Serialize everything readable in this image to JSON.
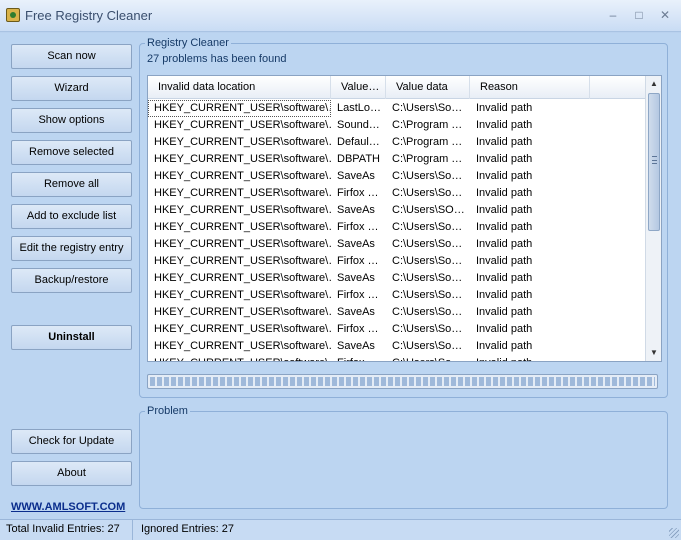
{
  "window": {
    "title": "Free Registry Cleaner"
  },
  "sidebar": {
    "buttons": [
      {
        "label": "Scan now",
        "name": "scan-now-button"
      },
      {
        "label": "Wizard",
        "name": "wizard-button"
      },
      {
        "label": "Show options",
        "name": "show-options-button"
      },
      {
        "label": "Remove selected",
        "name": "remove-selected-button"
      },
      {
        "label": "Remove all",
        "name": "remove-all-button"
      },
      {
        "label": "Add to exclude list",
        "name": "add-to-exclude-list-button"
      },
      {
        "label": "Edit the registry entry",
        "name": "edit-registry-entry-button"
      },
      {
        "label": "Backup/restore",
        "name": "backup-restore-button"
      }
    ],
    "uninstall_label": "Uninstall",
    "check_update_label": "Check for Update",
    "about_label": "About",
    "site_link": "WWW.AMLSOFT.COM"
  },
  "registry_group": {
    "title": "Registry Cleaner",
    "found_text": "27 problems has been found",
    "columns": [
      "Invalid data location",
      "Value…",
      "Value data",
      "Reason"
    ],
    "rows": [
      [
        "HKEY_CURRENT_USER\\software\\…",
        "LastLo…",
        "C:\\Users\\So…",
        "Invalid path"
      ],
      [
        "HKEY_CURRENT_USER\\software\\…",
        "Sound…",
        "C:\\Program …",
        "Invalid path"
      ],
      [
        "HKEY_CURRENT_USER\\software\\…",
        "Defaul…",
        "C:\\Program …",
        "Invalid path"
      ],
      [
        "HKEY_CURRENT_USER\\software\\…",
        "DBPATH",
        "C:\\Program …",
        "Invalid path"
      ],
      [
        "HKEY_CURRENT_USER\\software\\…",
        "SaveAs",
        "C:\\Users\\So…",
        "Invalid path"
      ],
      [
        "HKEY_CURRENT_USER\\software\\…",
        "Firfox …",
        "C:\\Users\\So…",
        "Invalid path"
      ],
      [
        "HKEY_CURRENT_USER\\software\\…",
        "SaveAs",
        "C:\\Users\\SO…",
        "Invalid path"
      ],
      [
        "HKEY_CURRENT_USER\\software\\…",
        "Firfox …",
        "C:\\Users\\So…",
        "Invalid path"
      ],
      [
        "HKEY_CURRENT_USER\\software\\…",
        "SaveAs",
        "C:\\Users\\So…",
        "Invalid path"
      ],
      [
        "HKEY_CURRENT_USER\\software\\…",
        "Firfox …",
        "C:\\Users\\So…",
        "Invalid path"
      ],
      [
        "HKEY_CURRENT_USER\\software\\…",
        "SaveAs",
        "C:\\Users\\So…",
        "Invalid path"
      ],
      [
        "HKEY_CURRENT_USER\\software\\…",
        "Firfox …",
        "C:\\Users\\So…",
        "Invalid path"
      ],
      [
        "HKEY_CURRENT_USER\\software\\…",
        "SaveAs",
        "C:\\Users\\So…",
        "Invalid path"
      ],
      [
        "HKEY_CURRENT_USER\\software\\…",
        "Firfox …",
        "C:\\Users\\So…",
        "Invalid path"
      ],
      [
        "HKEY_CURRENT_USER\\software\\…",
        "SaveAs",
        "C:\\Users\\So…",
        "Invalid path"
      ],
      [
        "HKEY_CURRENT_USER\\software\\…",
        "Firfox …",
        "C:\\Users\\So…",
        "Invalid path"
      ]
    ],
    "progress_fraction": 1.0
  },
  "problem_group": {
    "title": "Problem"
  },
  "statusbar": {
    "total": "Total Invalid Entries: 27",
    "ignored": "Ignored Entries: 27"
  },
  "colors": {
    "accent": "#0a2d8c",
    "background": "#bcd5f1"
  }
}
